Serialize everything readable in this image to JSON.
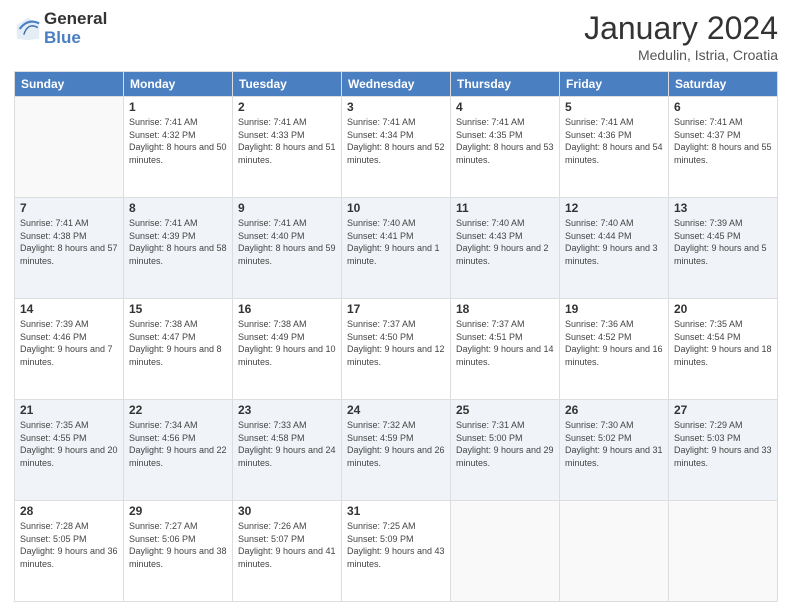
{
  "header": {
    "logo_general": "General",
    "logo_blue": "Blue",
    "main_title": "January 2024",
    "sub_title": "Medulin, Istria, Croatia"
  },
  "days_of_week": [
    "Sunday",
    "Monday",
    "Tuesday",
    "Wednesday",
    "Thursday",
    "Friday",
    "Saturday"
  ],
  "weeks": [
    [
      {
        "day": "",
        "sunrise": "",
        "sunset": "",
        "daylight": ""
      },
      {
        "day": "1",
        "sunrise": "Sunrise: 7:41 AM",
        "sunset": "Sunset: 4:32 PM",
        "daylight": "Daylight: 8 hours and 50 minutes."
      },
      {
        "day": "2",
        "sunrise": "Sunrise: 7:41 AM",
        "sunset": "Sunset: 4:33 PM",
        "daylight": "Daylight: 8 hours and 51 minutes."
      },
      {
        "day": "3",
        "sunrise": "Sunrise: 7:41 AM",
        "sunset": "Sunset: 4:34 PM",
        "daylight": "Daylight: 8 hours and 52 minutes."
      },
      {
        "day": "4",
        "sunrise": "Sunrise: 7:41 AM",
        "sunset": "Sunset: 4:35 PM",
        "daylight": "Daylight: 8 hours and 53 minutes."
      },
      {
        "day": "5",
        "sunrise": "Sunrise: 7:41 AM",
        "sunset": "Sunset: 4:36 PM",
        "daylight": "Daylight: 8 hours and 54 minutes."
      },
      {
        "day": "6",
        "sunrise": "Sunrise: 7:41 AM",
        "sunset": "Sunset: 4:37 PM",
        "daylight": "Daylight: 8 hours and 55 minutes."
      }
    ],
    [
      {
        "day": "7",
        "sunrise": "Sunrise: 7:41 AM",
        "sunset": "Sunset: 4:38 PM",
        "daylight": "Daylight: 8 hours and 57 minutes."
      },
      {
        "day": "8",
        "sunrise": "Sunrise: 7:41 AM",
        "sunset": "Sunset: 4:39 PM",
        "daylight": "Daylight: 8 hours and 58 minutes."
      },
      {
        "day": "9",
        "sunrise": "Sunrise: 7:41 AM",
        "sunset": "Sunset: 4:40 PM",
        "daylight": "Daylight: 8 hours and 59 minutes."
      },
      {
        "day": "10",
        "sunrise": "Sunrise: 7:40 AM",
        "sunset": "Sunset: 4:41 PM",
        "daylight": "Daylight: 9 hours and 1 minute."
      },
      {
        "day": "11",
        "sunrise": "Sunrise: 7:40 AM",
        "sunset": "Sunset: 4:43 PM",
        "daylight": "Daylight: 9 hours and 2 minutes."
      },
      {
        "day": "12",
        "sunrise": "Sunrise: 7:40 AM",
        "sunset": "Sunset: 4:44 PM",
        "daylight": "Daylight: 9 hours and 3 minutes."
      },
      {
        "day": "13",
        "sunrise": "Sunrise: 7:39 AM",
        "sunset": "Sunset: 4:45 PM",
        "daylight": "Daylight: 9 hours and 5 minutes."
      }
    ],
    [
      {
        "day": "14",
        "sunrise": "Sunrise: 7:39 AM",
        "sunset": "Sunset: 4:46 PM",
        "daylight": "Daylight: 9 hours and 7 minutes."
      },
      {
        "day": "15",
        "sunrise": "Sunrise: 7:38 AM",
        "sunset": "Sunset: 4:47 PM",
        "daylight": "Daylight: 9 hours and 8 minutes."
      },
      {
        "day": "16",
        "sunrise": "Sunrise: 7:38 AM",
        "sunset": "Sunset: 4:49 PM",
        "daylight": "Daylight: 9 hours and 10 minutes."
      },
      {
        "day": "17",
        "sunrise": "Sunrise: 7:37 AM",
        "sunset": "Sunset: 4:50 PM",
        "daylight": "Daylight: 9 hours and 12 minutes."
      },
      {
        "day": "18",
        "sunrise": "Sunrise: 7:37 AM",
        "sunset": "Sunset: 4:51 PM",
        "daylight": "Daylight: 9 hours and 14 minutes."
      },
      {
        "day": "19",
        "sunrise": "Sunrise: 7:36 AM",
        "sunset": "Sunset: 4:52 PM",
        "daylight": "Daylight: 9 hours and 16 minutes."
      },
      {
        "day": "20",
        "sunrise": "Sunrise: 7:35 AM",
        "sunset": "Sunset: 4:54 PM",
        "daylight": "Daylight: 9 hours and 18 minutes."
      }
    ],
    [
      {
        "day": "21",
        "sunrise": "Sunrise: 7:35 AM",
        "sunset": "Sunset: 4:55 PM",
        "daylight": "Daylight: 9 hours and 20 minutes."
      },
      {
        "day": "22",
        "sunrise": "Sunrise: 7:34 AM",
        "sunset": "Sunset: 4:56 PM",
        "daylight": "Daylight: 9 hours and 22 minutes."
      },
      {
        "day": "23",
        "sunrise": "Sunrise: 7:33 AM",
        "sunset": "Sunset: 4:58 PM",
        "daylight": "Daylight: 9 hours and 24 minutes."
      },
      {
        "day": "24",
        "sunrise": "Sunrise: 7:32 AM",
        "sunset": "Sunset: 4:59 PM",
        "daylight": "Daylight: 9 hours and 26 minutes."
      },
      {
        "day": "25",
        "sunrise": "Sunrise: 7:31 AM",
        "sunset": "Sunset: 5:00 PM",
        "daylight": "Daylight: 9 hours and 29 minutes."
      },
      {
        "day": "26",
        "sunrise": "Sunrise: 7:30 AM",
        "sunset": "Sunset: 5:02 PM",
        "daylight": "Daylight: 9 hours and 31 minutes."
      },
      {
        "day": "27",
        "sunrise": "Sunrise: 7:29 AM",
        "sunset": "Sunset: 5:03 PM",
        "daylight": "Daylight: 9 hours and 33 minutes."
      }
    ],
    [
      {
        "day": "28",
        "sunrise": "Sunrise: 7:28 AM",
        "sunset": "Sunset: 5:05 PM",
        "daylight": "Daylight: 9 hours and 36 minutes."
      },
      {
        "day": "29",
        "sunrise": "Sunrise: 7:27 AM",
        "sunset": "Sunset: 5:06 PM",
        "daylight": "Daylight: 9 hours and 38 minutes."
      },
      {
        "day": "30",
        "sunrise": "Sunrise: 7:26 AM",
        "sunset": "Sunset: 5:07 PM",
        "daylight": "Daylight: 9 hours and 41 minutes."
      },
      {
        "day": "31",
        "sunrise": "Sunrise: 7:25 AM",
        "sunset": "Sunset: 5:09 PM",
        "daylight": "Daylight: 9 hours and 43 minutes."
      },
      {
        "day": "",
        "sunrise": "",
        "sunset": "",
        "daylight": ""
      },
      {
        "day": "",
        "sunrise": "",
        "sunset": "",
        "daylight": ""
      },
      {
        "day": "",
        "sunrise": "",
        "sunset": "",
        "daylight": ""
      }
    ]
  ]
}
